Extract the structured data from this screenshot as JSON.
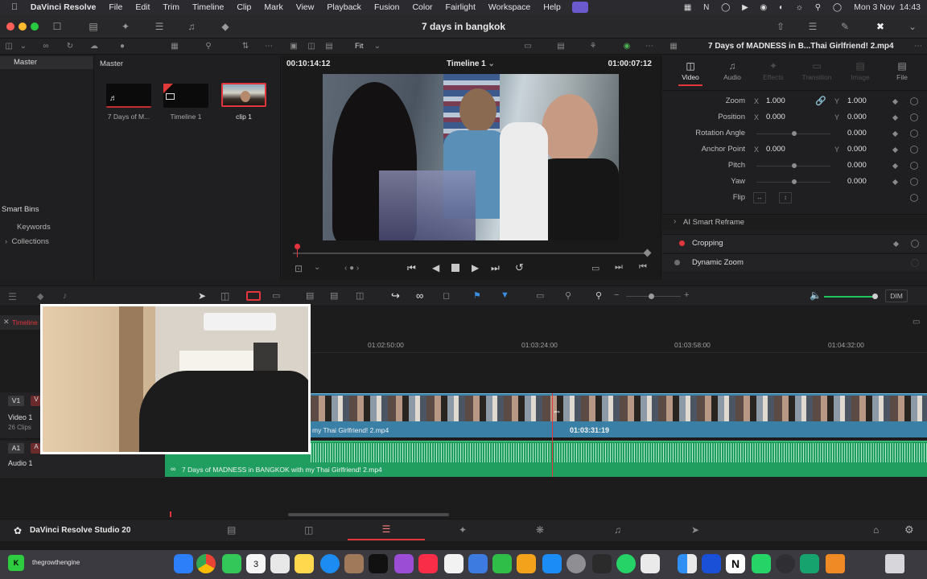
{
  "menubar": {
    "app": "DaVinci Resolve",
    "items": [
      "File",
      "Edit",
      "Trim",
      "Timeline",
      "Clip",
      "Mark",
      "View",
      "Playback",
      "Fusion",
      "Color",
      "Fairlight",
      "Workspace",
      "Help"
    ],
    "clock": "Mon 3 Nov  14:43"
  },
  "window": {
    "project_title": "7 days in bangkok"
  },
  "media_pool": {
    "master_label": "Master",
    "bin_header": "Master",
    "clips": [
      {
        "label": "7 Days of M..."
      },
      {
        "label": "Timeline 1"
      },
      {
        "label": "clip 1"
      }
    ],
    "smart_bins_label": "Smart Bins",
    "smart_bins": [
      "Keywords",
      "Collections"
    ]
  },
  "viewer": {
    "zoom_label": "Fit",
    "timecode_left": "00:10:14:12",
    "timeline_name": "Timeline 1",
    "timecode_right": "01:00:07:12"
  },
  "inspector": {
    "clip_name": "7 Days of MADNESS in B...Thai Girlfriend! 2.mp4",
    "tabs": [
      "Video",
      "Audio",
      "Effects",
      "Transition",
      "Image",
      "File"
    ],
    "active_tab": "Video",
    "rows": [
      {
        "label": "Zoom",
        "x": "1.000",
        "y": "1.000"
      },
      {
        "label": "Position",
        "x": "0.000",
        "y": "0.000"
      },
      {
        "label": "Rotation Angle",
        "value": "0.000"
      },
      {
        "label": "Anchor Point",
        "x": "0.000",
        "y": "0.000"
      },
      {
        "label": "Pitch",
        "value": "0.000"
      },
      {
        "label": "Yaw",
        "value": "0.000"
      },
      {
        "label": "Flip"
      }
    ],
    "axis_x": "X",
    "axis_y": "Y",
    "sections": [
      "AI Smart Reframe",
      "Cropping",
      "Dynamic Zoom"
    ]
  },
  "timeline": {
    "tab_label": "Timeline",
    "ruler": [
      "01:02:50:00",
      "01:03:24:00",
      "01:03:58:00",
      "01:04:32:00"
    ],
    "video_track": {
      "id": "V1",
      "name": "Video 1",
      "clips": "26 Clips"
    },
    "audio_track": {
      "id": "A1",
      "name": "Audio 1"
    },
    "video_clip_name": "my Thai Girlfriend! 2.mp4",
    "audio_clip_name": "7 Days of MADNESS in BANGKOK with my Thai Girlfriend! 2.mp4",
    "playhead_tc": "01:03:31:19",
    "dim_label": "DIM"
  },
  "footer": {
    "app_name": "DaVinci Resolve Studio 20"
  },
  "dock": {
    "webcam_label": "thegrowthengine",
    "calendar_day": "3"
  },
  "colors": {
    "accent_red": "#e2353c",
    "video_clip": "#3a7fa6",
    "audio_clip": "#1f9e5f",
    "volume": "#21c55d"
  }
}
